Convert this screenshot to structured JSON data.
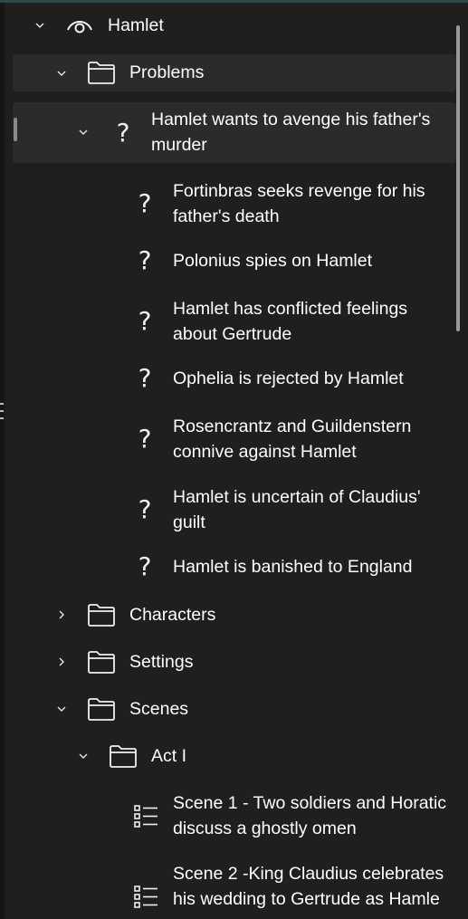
{
  "tree": {
    "root": {
      "label": "Hamlet",
      "icon": "eye-icon"
    },
    "problems_folder": {
      "label": "Problems",
      "icon": "folder-icon"
    },
    "main_problem": {
      "line1": "Hamlet wants to avenge his father's",
      "line2": "murder",
      "icon": "question-icon"
    },
    "sub_problems": [
      {
        "line1": "Fortinbras seeks revenge for his",
        "line2": "father's death"
      },
      {
        "line1": "Polonius spies on Hamlet",
        "line2": ""
      },
      {
        "line1": "Hamlet has conflicted feelings",
        "line2": "about Gertrude"
      },
      {
        "line1": "Ophelia is rejected by Hamlet",
        "line2": ""
      },
      {
        "line1": "Rosencrantz and Guildenstern",
        "line2": "connive against Hamlet"
      },
      {
        "line1": "Hamlet is uncertain of Claudius'",
        "line2": "guilt"
      },
      {
        "line1": "Hamlet is banished to England",
        "line2": ""
      }
    ],
    "characters_folder": {
      "label": "Characters",
      "icon": "folder-icon"
    },
    "settings_folder": {
      "label": "Settings",
      "icon": "folder-icon"
    },
    "scenes_folder": {
      "label": "Scenes",
      "icon": "folder-icon"
    },
    "act1_folder": {
      "label": "Act I",
      "icon": "folder-icon"
    },
    "scenes": [
      {
        "line1": "Scene 1 - Two soldiers and Horatic",
        "line2": "discuss a ghostly omen",
        "icon": "scene-list-icon"
      },
      {
        "line1": "Scene 2 -King Claudius celebrates",
        "line2": "his wedding to Gertrude as Hamle",
        "icon": "scene-list-icon"
      }
    ]
  },
  "colors": {
    "background": "#1f1f1f",
    "selected_row": "#2b2b2b",
    "text": "#ffffff"
  }
}
